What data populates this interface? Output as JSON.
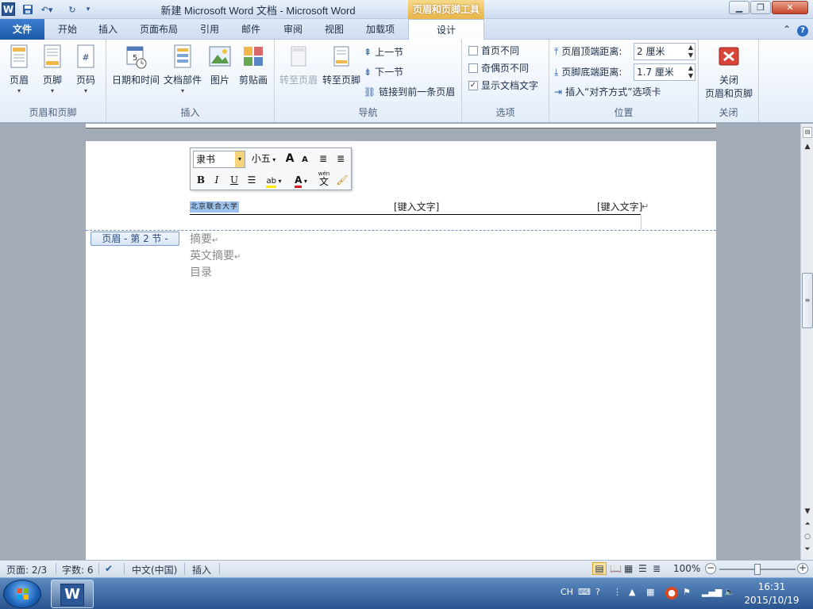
{
  "titlebar": {
    "app_title": "新建 Microsoft Word 文档 - Microsoft Word",
    "context_tool": "页眉和页脚工具",
    "word_icon": "W"
  },
  "tabs": [
    "文件",
    "开始",
    "插入",
    "页面布局",
    "引用",
    "邮件",
    "审阅",
    "视图",
    "加载项",
    "设计"
  ],
  "ribbon": {
    "groups": {
      "hf": {
        "label": "页眉和页脚",
        "header": "页眉",
        "footer": "页脚",
        "page_number": "页码"
      },
      "insert": {
        "label": "插入",
        "datetime": "日期和时间",
        "quickparts": "文档部件",
        "picture": "图片",
        "clipart": "剪贴画"
      },
      "nav": {
        "label": "导航",
        "goto_header": "转至页眉",
        "goto_footer": "转至页脚",
        "prev_section": "上一节",
        "next_section": "下一节",
        "link_prev": "链接到前一条页眉"
      },
      "options": {
        "label": "选项",
        "diff_first": "首页不同",
        "diff_oddeven": "奇偶页不同",
        "show_text": "显示文档文字"
      },
      "position": {
        "label": "位置",
        "header_top": "页眉顶端距离:",
        "header_top_value": "2 厘米",
        "footer_bottom": "页脚底端距离:",
        "footer_bottom_value": "1.7 厘米",
        "insert_align_tab": "插入“对齐方式”选项卡"
      },
      "close": {
        "label": "关闭",
        "close_btn_line1": "关闭",
        "close_btn_line2": "页眉和页脚"
      }
    }
  },
  "minitoolbar": {
    "font": "隶书",
    "size": "小五",
    "grow": "A",
    "shrink": "A",
    "bold": "B",
    "italic": "I",
    "underline": "U",
    "highlight": "ab",
    "fontcolor": "A",
    "phonetic_top": "wén",
    "phonetic_char": "文"
  },
  "document": {
    "header_left": "北京联合大学",
    "header_center": "[键入文字]",
    "header_right": "[键入文字]",
    "para_mark": "↵",
    "section_tag": "页眉 - 第 2 节 -",
    "lines": [
      "摘要",
      "英文摘要",
      "目录"
    ]
  },
  "statusbar": {
    "page": "页面: 2/3",
    "words": "字数: 6",
    "language": "中文(中国)",
    "mode": "插入",
    "zoom": "100%"
  },
  "taskbar": {
    "ime": "CH",
    "time": "16:31",
    "date": "2015/10/19"
  }
}
